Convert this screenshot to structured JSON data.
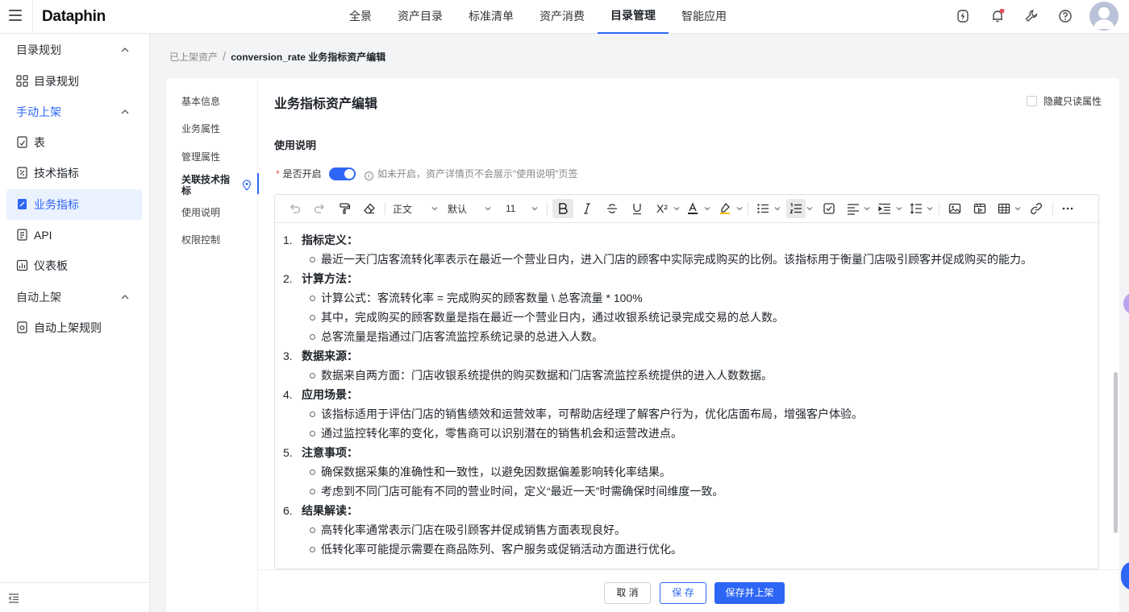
{
  "topbar": {
    "logo": "Dataphin",
    "nav": [
      "全景",
      "资产目录",
      "标准清单",
      "资产消费",
      "目录管理",
      "智能应用"
    ],
    "active_nav": "目录管理",
    "icons": [
      "lightning-icon",
      "bell-icon",
      "wrench-icon",
      "help-icon",
      "avatar"
    ],
    "notification_dot_color": "#e34d59"
  },
  "sidebar": {
    "groups": [
      {
        "label": "目录规划",
        "active": false,
        "items": [
          {
            "label": "目录规划",
            "icon": "grid-icon"
          }
        ]
      },
      {
        "label": "手动上架",
        "active": true,
        "items": [
          {
            "label": "表",
            "icon": "table-doc-icon"
          },
          {
            "label": "技术指标",
            "icon": "tech-metric-icon"
          },
          {
            "label": "业务指标",
            "icon": "business-metric-icon",
            "active": true
          },
          {
            "label": "API",
            "icon": "api-icon"
          },
          {
            "label": "仪表板",
            "icon": "dashboard-icon"
          }
        ]
      },
      {
        "label": "自动上架",
        "active": false,
        "items": [
          {
            "label": "自动上架规则",
            "icon": "auto-rule-icon"
          }
        ]
      }
    ]
  },
  "breadcrumb": {
    "parent": "已上架资产",
    "separator": "/",
    "current": "conversion_rate 业务指标资产编辑"
  },
  "anchors": [
    "基本信息",
    "业务属性",
    "管理属性",
    "关联技术指标",
    "使用说明",
    "权限控制"
  ],
  "active_anchor": "关联技术指标",
  "card": {
    "title": "业务指标资产编辑",
    "hide_readonly_label": "隐藏只读属性",
    "section_title": "使用说明",
    "switch_label": "是否开启",
    "switch_on": true,
    "switch_hint": "如未开启，资产详情页不会展示\"使用说明\"页签"
  },
  "editor": {
    "toolbar": {
      "paragraph_style": "正文",
      "font": "默认",
      "font_size": "11",
      "superscript_label": "X²"
    },
    "content": [
      {
        "num": "1.",
        "title": "指标定义：",
        "bullets": [
          "最近一天门店客流转化率表示在最近一个营业日内，进入门店的顾客中实际完成购买的比例。该指标用于衡量门店吸引顾客并促成购买的能力。"
        ]
      },
      {
        "num": "2.",
        "title": "计算方法：",
        "bullets": [
          "计算公式：客流转化率 = 完成购买的顾客数量 \\ 总客流量 * 100%",
          "其中，完成购买的顾客数量是指在最近一个营业日内，通过收银系统记录完成交易的总人数。",
          "总客流量是指通过门店客流监控系统记录的总进入人数。"
        ]
      },
      {
        "num": "3.",
        "title": "数据来源：",
        "bullets": [
          "数据来自两方面：门店收银系统提供的购买数据和门店客流监控系统提供的进入人数数据。"
        ]
      },
      {
        "num": "4.",
        "title": "应用场景：",
        "bullets": [
          "该指标适用于评估门店的销售绩效和运营效率，可帮助店经理了解客户行为，优化店面布局，增强客户体验。",
          "通过监控转化率的变化，零售商可以识别潜在的销售机会和运营改进点。"
        ]
      },
      {
        "num": "5.",
        "title": "注意事项：",
        "bullets": [
          "确保数据采集的准确性和一致性，以避免因数据偏差影响转化率结果。",
          "考虑到不同门店可能有不同的营业时间，定义“最近一天”时需确保时间维度一致。"
        ]
      },
      {
        "num": "6.",
        "title": "结果解读：",
        "bullets": [
          "高转化率通常表示门店在吸引顾客并促成销售方面表现良好。",
          "低转化率可能提示需要在商品陈列、客户服务或促销活动方面进行优化。"
        ]
      }
    ]
  },
  "footer": {
    "cancel": "取 消",
    "save": "保 存",
    "save_publish": "保存并上架"
  },
  "colors": {
    "primary": "#2d65f5",
    "active_bg": "#eaf1ff",
    "required": "#e34d59"
  }
}
